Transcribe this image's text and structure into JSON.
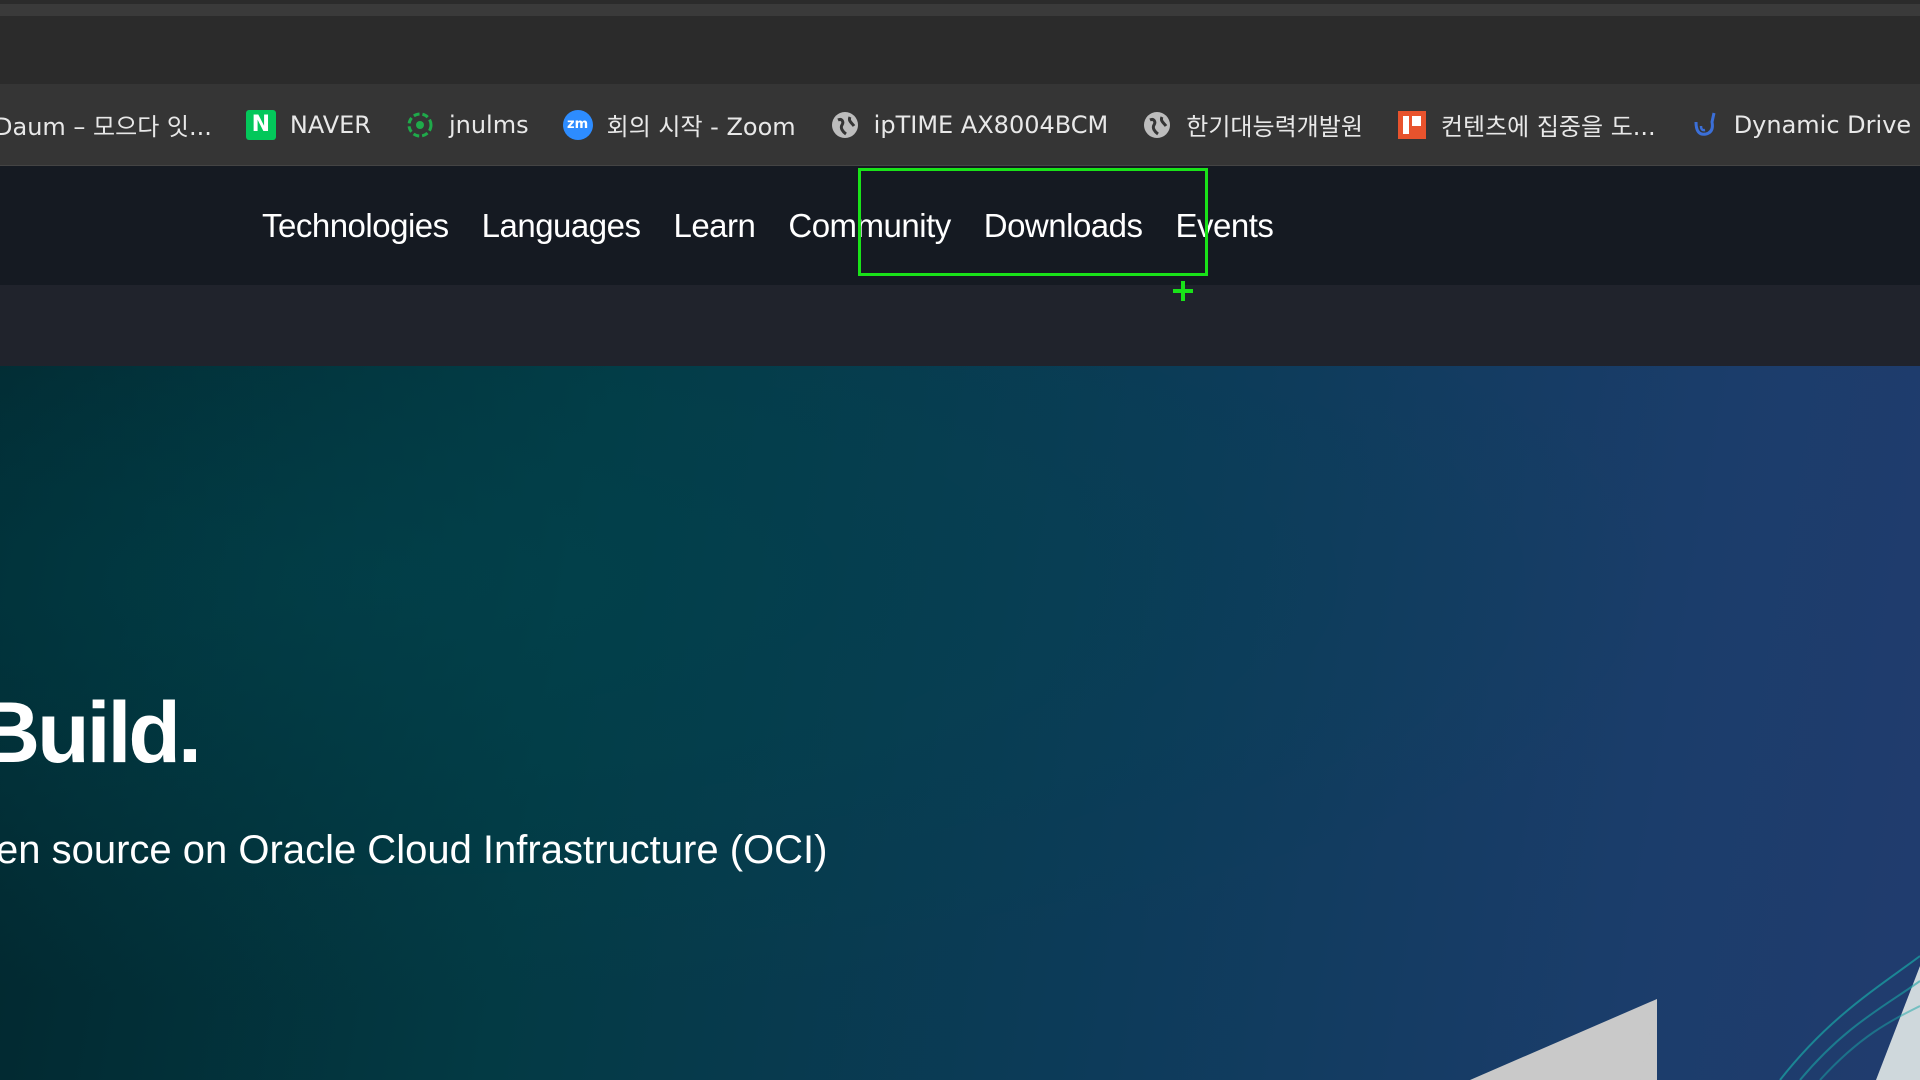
{
  "bookmarks": [
    {
      "label": "Daum – 모으다 잇...",
      "icon": "daum-icon"
    },
    {
      "label": "NAVER",
      "icon": "naver-icon",
      "glyph": "N"
    },
    {
      "label": "jnulms",
      "icon": "jnulms-icon"
    },
    {
      "label": "회의 시작 - Zoom",
      "icon": "zoom-icon",
      "glyph": "zm"
    },
    {
      "label": "ipTIME AX8004BCM",
      "icon": "globe-icon"
    },
    {
      "label": "한기대능력개발원",
      "icon": "globe-icon"
    },
    {
      "label": "컨텐츠에 집중을 도...",
      "icon": "bookmark-orange-icon"
    },
    {
      "label": "Dynamic Drive CSS",
      "icon": "dynamic-drive-icon"
    }
  ],
  "nav": {
    "items": [
      "Technologies",
      "Languages",
      "Learn",
      "Community",
      "Downloads",
      "Events"
    ]
  },
  "hero": {
    "title": "Build.",
    "subtitle": "en source on Oracle Cloud Infrastructure (OCI)"
  },
  "colors": {
    "highlight": "#19e219",
    "nav_bg": "#151a22",
    "hero_start": "#02262d",
    "hero_end": "#213c6e"
  }
}
